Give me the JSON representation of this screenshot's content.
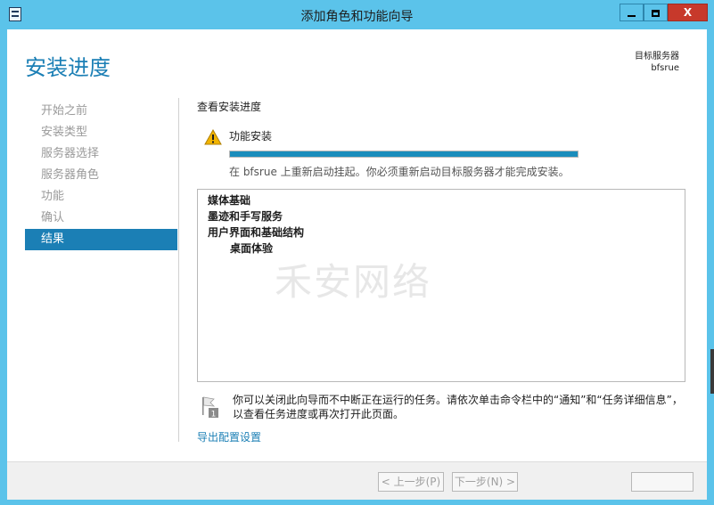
{
  "window": {
    "title": "添加角色和功能向导",
    "close_label": "X"
  },
  "header": {
    "page_title": "安装进度",
    "target_label": "目标服务器",
    "target_name": "bfsrue"
  },
  "nav": {
    "items": [
      {
        "label": "开始之前"
      },
      {
        "label": "安装类型"
      },
      {
        "label": "服务器选择"
      },
      {
        "label": "服务器角色"
      },
      {
        "label": "功能"
      },
      {
        "label": "确认"
      },
      {
        "label": "结果"
      }
    ],
    "active_index": 6
  },
  "content": {
    "section_title": "查看安装进度",
    "status_label": "功能安装",
    "progress_fraction": 1.0,
    "status_message": "在 bfsrue 上重新启动挂起。你必须重新启动目标服务器才能完成安装。",
    "results": [
      {
        "label": "媒体基础",
        "level": 0
      },
      {
        "label": "墨迹和手写服务",
        "level": 0
      },
      {
        "label": "用户界面和基础结构",
        "level": 0
      },
      {
        "label": "桌面体验",
        "level": 1
      }
    ],
    "note": "你可以关闭此向导而不中断正在运行的任务。请依次单击命令栏中的“通知”和“任务详细信息”，以查看任务进度或再次打开此页面。",
    "note_badge": "1",
    "export_link": "导出配置设置"
  },
  "footer": {
    "prev_label": "< 上一步(P)",
    "next_label": "下一步(N) >"
  },
  "watermark": "禾安网络",
  "colors": {
    "titlebar": "#5bc3ea",
    "accent": "#1b7fb5",
    "progress": "#1a8dbc",
    "close": "#c7392b"
  }
}
